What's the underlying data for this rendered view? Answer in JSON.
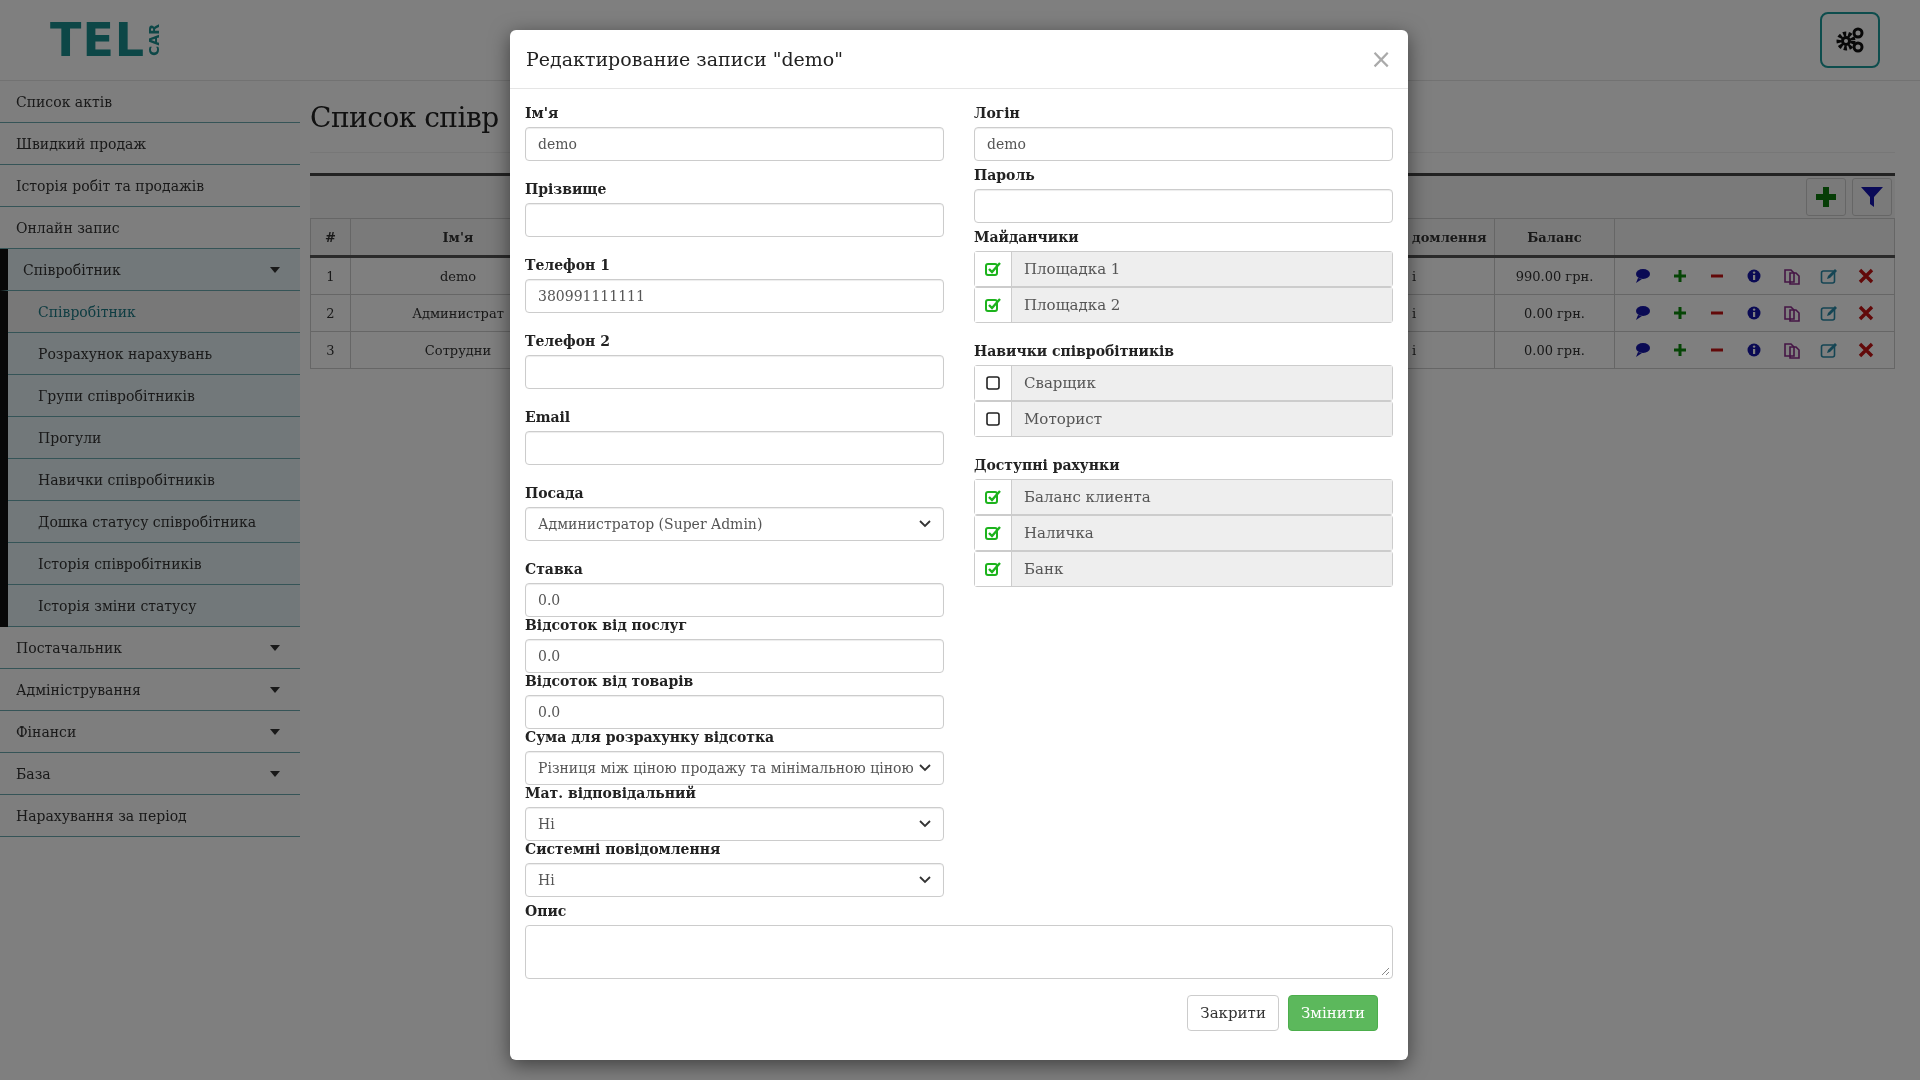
{
  "header": {
    "logo_main": "TEL",
    "logo_side": "CAR"
  },
  "sidebar": {
    "items": [
      {
        "label": "Список актів",
        "kind": "link",
        "selected": false
      },
      {
        "label": "Швидкий продаж",
        "kind": "link",
        "selected": false
      },
      {
        "label": "Історія робіт та продажів",
        "kind": "link",
        "selected": false
      },
      {
        "label": "Онлайн запис",
        "kind": "link",
        "selected": false
      },
      {
        "label": "Співробітник",
        "kind": "group",
        "expanded": true,
        "selected": false,
        "children": [
          {
            "label": "Співробітник",
            "selected": true
          },
          {
            "label": "Розрахунок нарахувань",
            "selected": false
          },
          {
            "label": "Групи співробітників",
            "selected": false
          },
          {
            "label": "Прогули",
            "selected": false
          },
          {
            "label": "Навички співробітників",
            "selected": false
          },
          {
            "label": "Дошка статусу співробітника",
            "selected": false
          },
          {
            "label": "Історія співробітників",
            "selected": false
          },
          {
            "label": "Історія зміни статусу",
            "selected": false
          }
        ]
      },
      {
        "label": "Постачальник",
        "kind": "group",
        "expanded": false,
        "selected": false
      },
      {
        "label": "Адміністрування",
        "kind": "group",
        "expanded": false,
        "selected": false
      },
      {
        "label": "Фінанси",
        "kind": "group",
        "expanded": false,
        "selected": false
      },
      {
        "label": "База",
        "kind": "group",
        "expanded": false,
        "selected": false
      },
      {
        "label": "Нарахування за період",
        "kind": "link",
        "selected": false
      }
    ]
  },
  "page": {
    "title": "Список співр",
    "table": {
      "columns": [
        "#",
        "Ім'я",
        "домлення",
        "Баланс"
      ],
      "rows": [
        {
          "cells": [
            "1",
            "demo",
            "і",
            "990.00 грн."
          ]
        },
        {
          "cells": [
            "2",
            "Администрат",
            "і",
            "0.00 грн."
          ]
        },
        {
          "cells": [
            "3",
            "Сотрудни",
            "і",
            "0.00 грн."
          ]
        }
      ]
    }
  },
  "modal": {
    "title": "Редактирование записи \"demo\"",
    "close": "×",
    "left_fields": [
      {
        "label": "Ім'я",
        "kind": "input",
        "value": "demo"
      },
      {
        "label": "Прізвище",
        "kind": "input"
      },
      {
        "label": "Телефон 1",
        "kind": "input",
        "value": "380991111111"
      },
      {
        "label": "Телефон 2",
        "kind": "input"
      },
      {
        "label": "Email",
        "kind": "input"
      },
      {
        "label": "Посада",
        "kind": "select",
        "value": "Администратор (Super Admin)"
      },
      {
        "label": "Ставка",
        "kind": "input",
        "value": "0.0"
      },
      {
        "label": "Відсоток від послуг",
        "kind": "input",
        "value": "0.0"
      },
      {
        "label": "Відсоток від товарів",
        "kind": "input",
        "value": "0.0"
      },
      {
        "label": "Сума для розрахунку відсотка",
        "kind": "select",
        "value": "Різниця між ціною продажу та мінімальною ціною"
      },
      {
        "label": "Мат. відповідальний",
        "kind": "select",
        "value": "Ні"
      },
      {
        "label": "Системні повідомлення",
        "kind": "select",
        "value": "Ні"
      }
    ],
    "right_fields": [
      {
        "label": "Логін",
        "kind": "input",
        "value": "demo"
      },
      {
        "label": "Пароль",
        "kind": "input"
      }
    ],
    "groups": [
      {
        "label": "Майданчики",
        "options": [
          {
            "label": "Площадка 1",
            "checked": true
          },
          {
            "label": "Площадка 2",
            "checked": true
          }
        ]
      },
      {
        "label": "Навички співробітників",
        "options": [
          {
            "label": "Сварщик",
            "checked": false
          },
          {
            "label": "Моторист",
            "checked": false
          }
        ]
      },
      {
        "label": "Доступні рахунки",
        "options": [
          {
            "label": "Баланс клиента",
            "checked": true
          },
          {
            "label": "Наличка",
            "checked": true
          },
          {
            "label": "Банк",
            "checked": true
          }
        ]
      }
    ],
    "description": {
      "label": "Опис"
    },
    "buttons": [
      {
        "label": "Закрити",
        "kind": "default"
      },
      {
        "label": "Змінити",
        "kind": "primary"
      }
    ]
  }
}
